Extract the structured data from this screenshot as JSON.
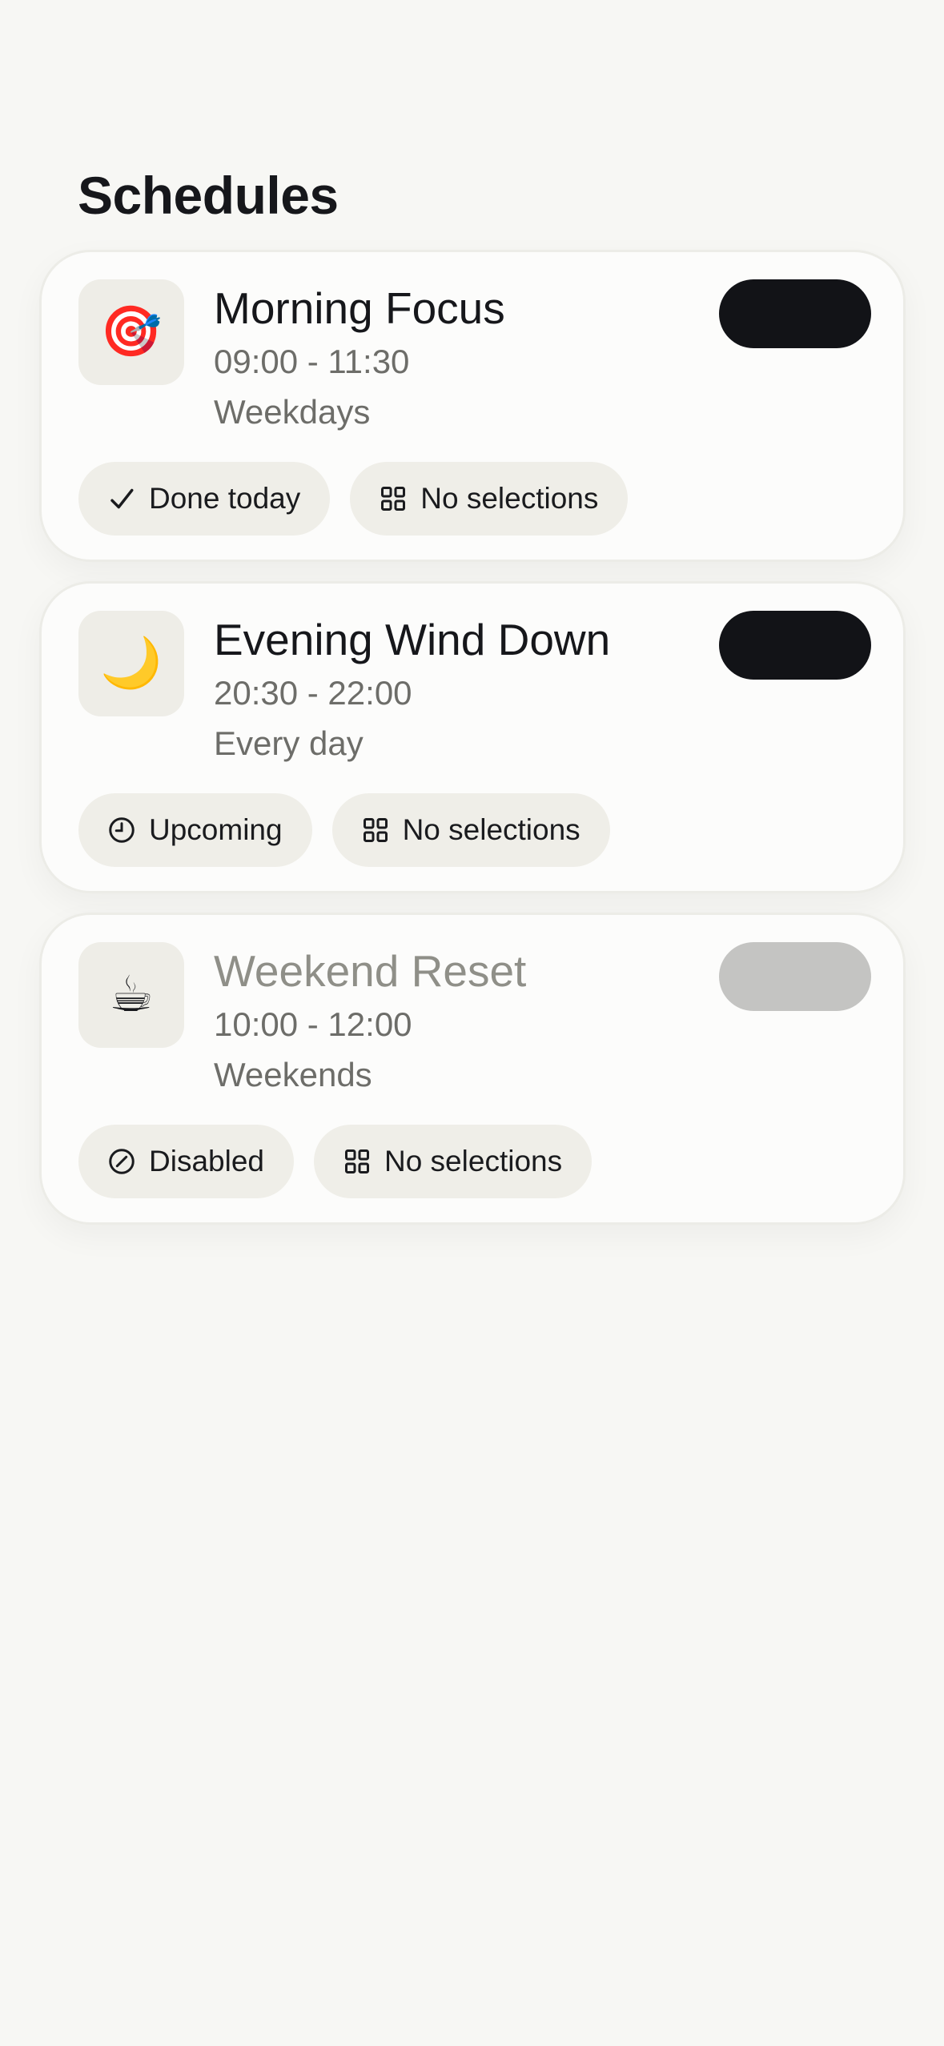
{
  "page": {
    "title": "Schedules"
  },
  "colors": {
    "background": "#f7f7f4",
    "card": "#fcfcfb",
    "toggle_on": "#121317",
    "toggle_off": "#c4c4c2",
    "chip": "#efeee8",
    "muted_text": "#6d6d69"
  },
  "schedules": [
    {
      "icon": "🎯",
      "icon_name": "target-dart-icon",
      "title": "Morning Focus",
      "time": "09:00 - 11:30",
      "days": "Weekdays",
      "enabled": true,
      "status_label": "Done today",
      "status_icon": "checkmark-icon",
      "selections_label": "No selections",
      "selections_icon": "grid-icon"
    },
    {
      "icon": "🌙",
      "icon_name": "crescent-moon-icon",
      "title": "Evening Wind Down",
      "time": "20:30 - 22:00",
      "days": "Every day",
      "enabled": true,
      "status_label": "Upcoming",
      "status_icon": "clock-icon",
      "selections_label": "No selections",
      "selections_icon": "grid-icon"
    },
    {
      "icon": "☕",
      "icon_name": "coffee-cup-icon",
      "title": "Weekend Reset",
      "time": "10:00 - 12:00",
      "days": "Weekends",
      "enabled": false,
      "status_label": "Disabled",
      "status_icon": "disabled-icon",
      "selections_label": "No selections",
      "selections_icon": "grid-icon"
    }
  ]
}
